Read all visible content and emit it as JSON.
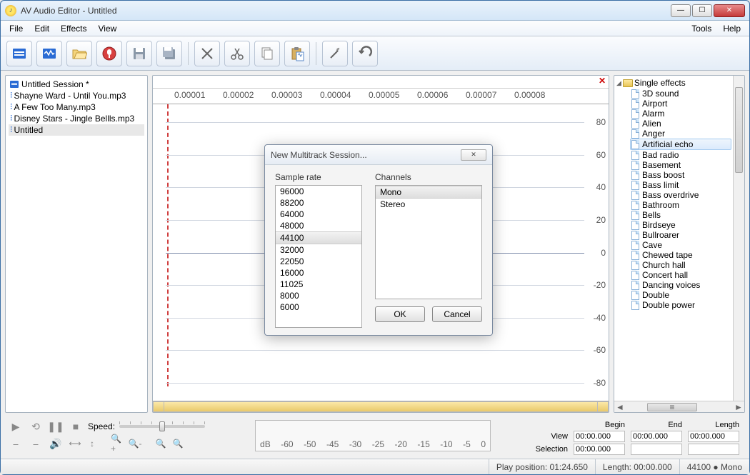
{
  "window": {
    "title": "AV Audio Editor - Untitled"
  },
  "menus": {
    "left": [
      "File",
      "Edit",
      "Effects",
      "View"
    ],
    "right": [
      "Tools",
      "Help"
    ]
  },
  "toolbar_icons": [
    "new-session",
    "new-file",
    "open",
    "record",
    "save",
    "save-all",
    "cut",
    "copy-cut",
    "copy",
    "paste",
    "effects-wand",
    "undo"
  ],
  "files": {
    "items": [
      {
        "label": "Untitled Session *",
        "type": "session"
      },
      {
        "label": "Shayne Ward - Until You.mp3",
        "type": "audio"
      },
      {
        "label": "A Few Too Many.mp3",
        "type": "audio"
      },
      {
        "label": "Disney Stars - Jingle Bellls.mp3",
        "type": "audio"
      },
      {
        "label": "Untitled",
        "type": "audio"
      }
    ],
    "selected_index": 4
  },
  "ruler_ticks": [
    "0.00001",
    "0.00002",
    "0.00003",
    "0.00004",
    "0.00005",
    "0.00006",
    "0.00007",
    "0.00008"
  ],
  "yaxis": [
    "80",
    "60",
    "40",
    "20",
    "0",
    "-20",
    "-40",
    "-60",
    "-80"
  ],
  "effects_tree": {
    "root_label": "Single effects",
    "items": [
      "3D sound",
      "Airport",
      "Alarm",
      "Alien",
      "Anger",
      "Artificial echo",
      "Bad radio",
      "Basement",
      "Bass boost",
      "Bass limit",
      "Bass overdrive",
      "Bathroom",
      "Bells",
      "Birdseye",
      "Bullroarer",
      "Cave",
      "Chewed tape",
      "Church hall",
      "Concert hall",
      "Dancing voices",
      "Double",
      "Double power"
    ],
    "selected_index": 5
  },
  "transport": {
    "speed_label": "Speed:"
  },
  "db_scale": [
    "dB",
    "-60",
    "-50",
    "-45",
    "-30",
    "-25",
    "-20",
    "-15",
    "-10",
    "-5",
    "0"
  ],
  "time_grid": {
    "cols": [
      "Begin",
      "End",
      "Length"
    ],
    "rows": [
      "View",
      "Selection"
    ],
    "view": [
      "00:00.000",
      "00:00.000",
      "00:00.000"
    ],
    "selection": [
      "00:00.000",
      "",
      ""
    ]
  },
  "status": {
    "play_position": "Play position: 01:24.650",
    "length": "Length: 00:00.000",
    "format": "44100 ● Mono"
  },
  "dialog": {
    "title": "New Multitrack Session...",
    "sample_rate_label": "Sample rate",
    "channels_label": "Channels",
    "sample_rates": [
      "96000",
      "88200",
      "64000",
      "48000",
      "44100",
      "32000",
      "22050",
      "16000",
      "11025",
      "8000",
      "6000"
    ],
    "sample_rate_selected": 4,
    "channels": [
      "Mono",
      "Stereo"
    ],
    "channel_selected": 0,
    "ok": "OK",
    "cancel": "Cancel"
  }
}
